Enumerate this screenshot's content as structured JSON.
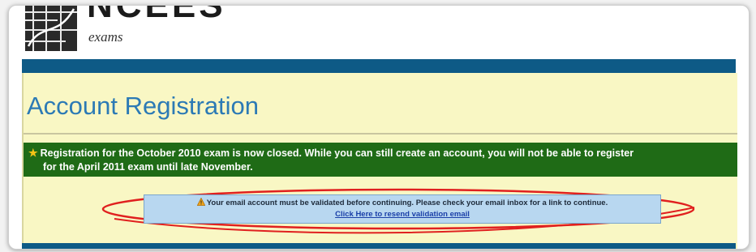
{
  "header": {
    "logo_text": "NCEES",
    "logo_subtitle": "exams"
  },
  "page": {
    "title": "Account Registration"
  },
  "notice": {
    "icon": "star-icon",
    "line1": "Registration for the October 2010 exam is now closed. While you can still create an account, you will not be able to register",
    "line2": "for the April 2011 exam until late November."
  },
  "alert": {
    "icon": "warning-icon",
    "message": "Your email account must be validated before continuing. Please check your email inbox for a link to continue.",
    "link_label": "Click Here to resend validation email"
  },
  "colors": {
    "header_bar": "#0e5a86",
    "content_bg": "#f9f7c4",
    "notice_bg": "#1f6b16",
    "alert_bg": "#b8d7f0",
    "title_text": "#2c7ab5",
    "highlight": "#e0201f"
  }
}
